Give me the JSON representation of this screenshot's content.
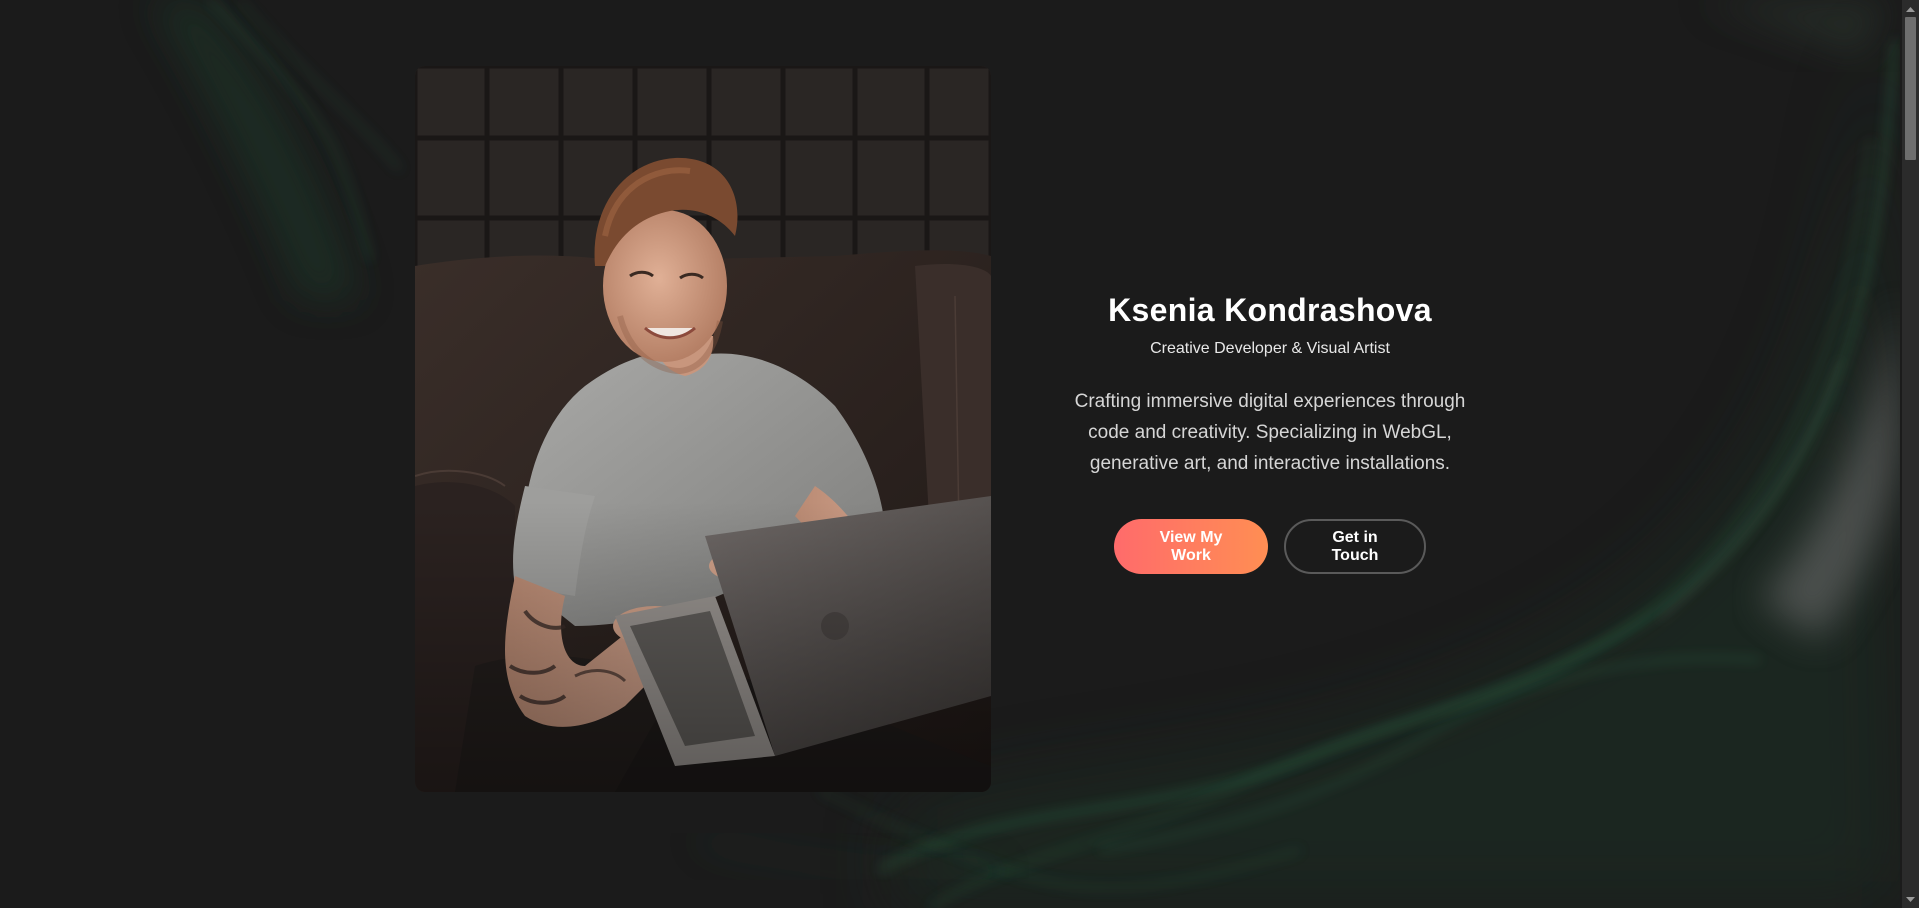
{
  "hero": {
    "name": "Ksenia Kondrashova",
    "role": "Creative Developer & Visual Artist",
    "description": "Crafting immersive digital experiences through code and creativity. Specializing in WebGL, generative art, and interactive installations.",
    "primary_button": "View My Work",
    "secondary_button": "Get in Touch"
  },
  "photo": {
    "subject": "man-with-laptop-photo"
  },
  "colors": {
    "background": "#1b1b1b",
    "accent_start": "#ff6b6b",
    "accent_end": "#ff8e53",
    "smoke_green": "#2f7d52"
  },
  "icons": {
    "scroll_up": "chevron-up-icon",
    "scroll_down": "chevron-down-icon"
  }
}
